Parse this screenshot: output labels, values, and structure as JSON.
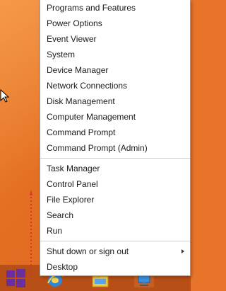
{
  "menu": {
    "group1": [
      {
        "label": "Programs and Features"
      },
      {
        "label": "Power Options"
      },
      {
        "label": "Event Viewer"
      },
      {
        "label": "System"
      },
      {
        "label": "Device Manager"
      },
      {
        "label": "Network Connections"
      },
      {
        "label": "Disk Management"
      },
      {
        "label": "Computer Management"
      },
      {
        "label": "Command Prompt"
      },
      {
        "label": "Command Prompt (Admin)"
      }
    ],
    "group2": [
      {
        "label": "Task Manager"
      },
      {
        "label": "Control Panel"
      },
      {
        "label": "File Explorer"
      },
      {
        "label": "Search"
      },
      {
        "label": "Run"
      }
    ],
    "group3": [
      {
        "label": "Shut down or sign out",
        "has_submenu": true
      },
      {
        "label": "Desktop"
      }
    ]
  },
  "colors": {
    "desktop_background": "#e8742a",
    "taskbar": "#b84f17",
    "start_button": "#5b2a8c",
    "annotation_arrow": "#e0302a"
  },
  "taskbar": {
    "icons": [
      "windows-start-icon",
      "internet-explorer-icon",
      "file-explorer-icon",
      "network-icon"
    ]
  }
}
